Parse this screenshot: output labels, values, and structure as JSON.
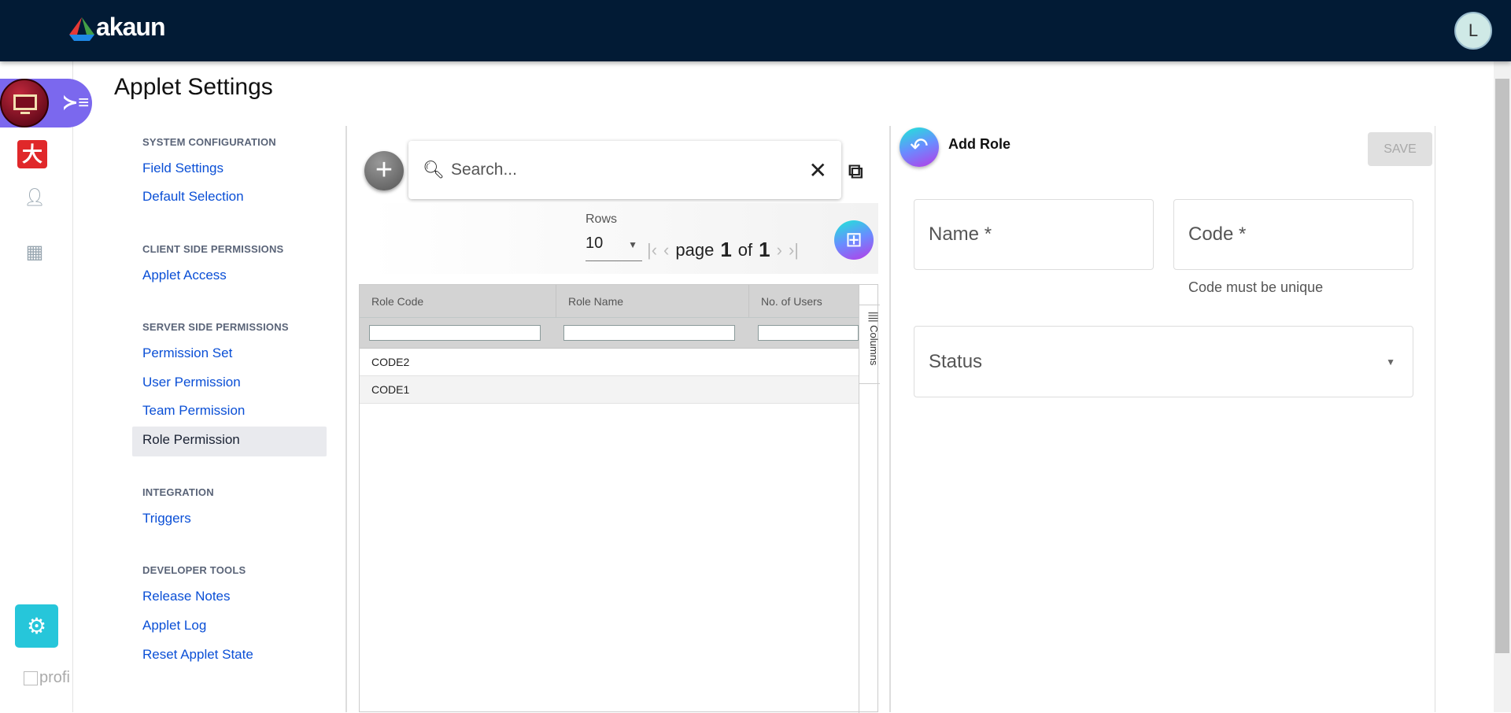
{
  "header": {
    "logo": "akaun",
    "avatar_initial": "L"
  },
  "rail": {
    "icons": [
      "desktop-app-icon",
      "pdf-app-icon",
      "person-icon",
      "grid-icon"
    ],
    "settings_icon": "gear-icon",
    "profile_label": "profi"
  },
  "page": {
    "title": "Applet Settings"
  },
  "nav": {
    "sections": [
      {
        "heading": "SYSTEM CONFIGURATION",
        "items": [
          "Field Settings",
          "Default Selection"
        ]
      },
      {
        "heading": "CLIENT SIDE PERMISSIONS",
        "items": [
          "Applet Access"
        ]
      },
      {
        "heading": "SERVER SIDE PERMISSIONS",
        "items": [
          "Permission Set",
          "User Permission",
          "Team Permission",
          "Role Permission"
        ]
      },
      {
        "heading": "INTEGRATION",
        "items": [
          "Triggers"
        ]
      },
      {
        "heading": "DEVELOPER TOOLS",
        "items": [
          "Release Notes",
          "Applet Log",
          "Reset Applet State"
        ]
      }
    ],
    "selected": "Role Permission"
  },
  "list": {
    "search_placeholder": "Search...",
    "rows_label": "Rows",
    "rows_value": "10",
    "page_word": "page",
    "page_current": "1",
    "of_word": "of",
    "page_total": "1",
    "columns": [
      "Role Code",
      "Role Name",
      "No. of Users"
    ],
    "rows": [
      [
        "CODE2",
        "",
        ""
      ],
      [
        "CODE1",
        "",
        ""
      ]
    ],
    "columns_tab": "Columns"
  },
  "form": {
    "title": "Add Role",
    "save_label": "SAVE",
    "name_label": "Name *",
    "code_label": "Code *",
    "code_helper": "Code must be unique",
    "status_label": "Status"
  }
}
